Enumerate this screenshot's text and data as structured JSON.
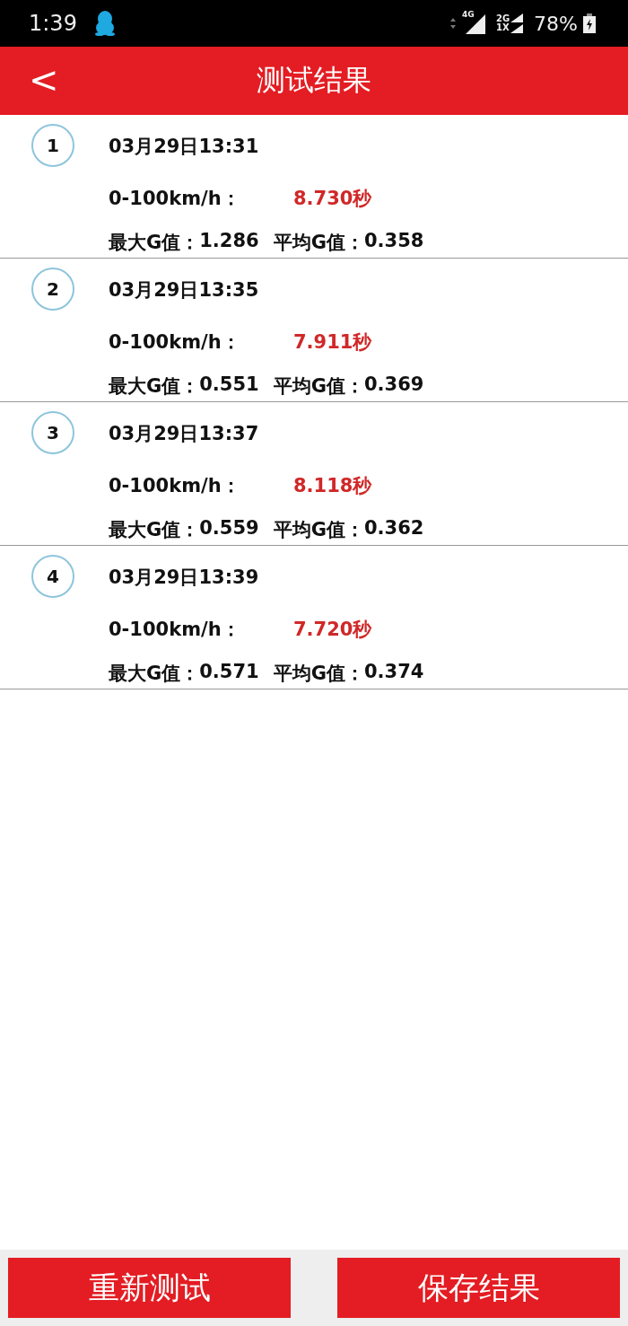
{
  "status_bar": {
    "time": "1:39",
    "network_1": "4G",
    "network_2": "2G",
    "network_3": "1X",
    "battery": "78%"
  },
  "header": {
    "back": "<",
    "title": "测试结果"
  },
  "results": [
    {
      "index": "1",
      "datetime": "03月29日13:31",
      "speed_label": "0-100km/h：",
      "time": "8.730秒",
      "max_g_label": "最大G值：",
      "max_g": "1.286",
      "avg_g_label": "平均G值：",
      "avg_g": "0.358"
    },
    {
      "index": "2",
      "datetime": "03月29日13:35",
      "speed_label": "0-100km/h：",
      "time": "7.911秒",
      "max_g_label": "最大G值：",
      "max_g": "0.551",
      "avg_g_label": "平均G值：",
      "avg_g": "0.369"
    },
    {
      "index": "3",
      "datetime": "03月29日13:37",
      "speed_label": "0-100km/h：",
      "time": "8.118秒",
      "max_g_label": "最大G值：",
      "max_g": "0.559",
      "avg_g_label": "平均G值：",
      "avg_g": "0.362"
    },
    {
      "index": "4",
      "datetime": "03月29日13:39",
      "speed_label": "0-100km/h：",
      "time": "7.720秒",
      "max_g_label": "最大G值：",
      "max_g": "0.571",
      "avg_g_label": "平均G值：",
      "avg_g": "0.374"
    }
  ],
  "buttons": [
    "重新测试",
    "保存结果"
  ]
}
